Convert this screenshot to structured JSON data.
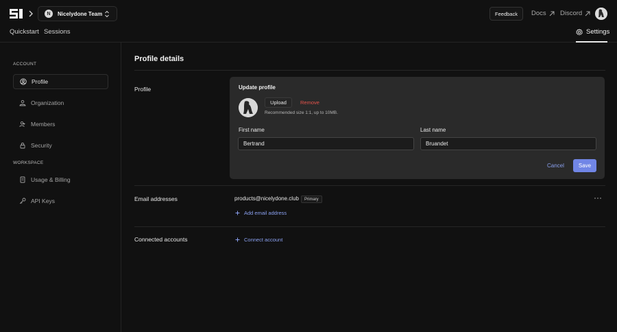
{
  "header": {
    "team": {
      "initial": "N",
      "name": "Nicelydone Team"
    },
    "tabs": [
      {
        "label": "Quickstart"
      },
      {
        "label": "Sessions"
      }
    ],
    "feedback_label": "Feedback",
    "links": [
      {
        "label": "Docs"
      },
      {
        "label": "Discord"
      }
    ],
    "settings_label": "Settings"
  },
  "sidebar": {
    "account_label": "ACCOUNT",
    "account_items": [
      {
        "label": "Profile",
        "icon": "user-circle-icon",
        "active": true
      },
      {
        "label": "Organization",
        "icon": "organization-icon"
      },
      {
        "label": "Members",
        "icon": "members-icon"
      },
      {
        "label": "Security",
        "icon": "lock-icon"
      }
    ],
    "workspace_label": "WORKSPACE",
    "workspace_items": [
      {
        "label": "Usage & Billing",
        "icon": "receipt-icon"
      },
      {
        "label": "API Keys",
        "icon": "key-icon"
      }
    ]
  },
  "main": {
    "title": "Profile details",
    "profile": {
      "row_label": "Profile",
      "card_title": "Update profile",
      "upload_label": "Upload",
      "remove_label": "Remove",
      "hint": "Recommended size 1:1, up to 10MB.",
      "first_name_label": "First name",
      "first_name_value": "Bertrand",
      "last_name_label": "Last name",
      "last_name_value": "Bruandet",
      "cancel_label": "Cancel",
      "save_label": "Save"
    },
    "email": {
      "row_label": "Email addresses",
      "address": "products@nicelydone.club",
      "badge": "Primary",
      "add_label": "Add email address"
    },
    "connected": {
      "row_label": "Connected accounts",
      "add_label": "Connect account"
    }
  },
  "colors": {
    "accent": "#7186e6",
    "danger": "#e5534b",
    "link": "#8aa0ef"
  }
}
